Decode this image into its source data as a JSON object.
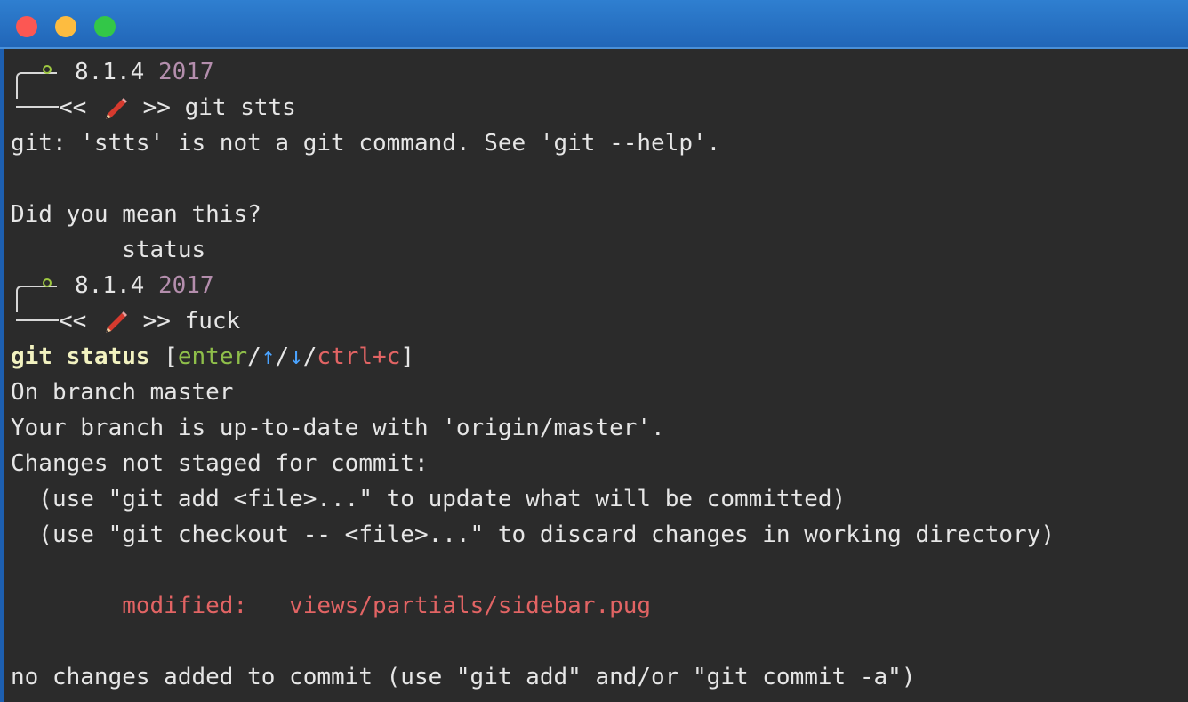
{
  "window": {
    "controls": [
      "close",
      "minimize",
      "maximize"
    ]
  },
  "prompts": [
    {
      "version": "8.1.4",
      "year": "2017",
      "left_marker": "<<",
      "right_marker": ">>",
      "command": "git stts"
    },
    {
      "version": "8.1.4",
      "year": "2017",
      "left_marker": "<<",
      "right_marker": ">>",
      "command": "fuck"
    }
  ],
  "output": {
    "error": "git: 'stts' is not a git command. See 'git --help'.",
    "did_you_mean": "Did you mean this?",
    "suggestion": "        status",
    "selected_command": "git status",
    "choice_open": " [",
    "choice_enter": "enter",
    "choice_sep1": "/",
    "choice_up": "↑",
    "choice_sep2": "/",
    "choice_down": "↓",
    "choice_sep3": "/",
    "choice_cancel": "ctrl+c",
    "choice_close": "]",
    "branch": "On branch master",
    "up_to_date": "Your branch is up-to-date with 'origin/master'.",
    "not_staged": "Changes not staged for commit:",
    "hint_add": "  (use \"git add <file>...\" to update what will be committed)",
    "hint_checkout": "  (use \"git checkout -- <file>...\" to discard changes in working directory)",
    "modified_label": "        modified:   ",
    "modified_file": "views/partials/sidebar.pug",
    "no_changes": "no changes added to commit (use \"git add\" and/or \"git commit -a\")"
  },
  "colors": {
    "background": "#2b2b2b",
    "text": "#e6e6e6",
    "year": "#b48ead",
    "enter": "#8fbf4a",
    "arrows": "#4aa3ff",
    "cancel": "#e26464",
    "modified": "#e26464"
  },
  "icons": [
    "pencil-icon",
    "prompt-ring-icon"
  ]
}
